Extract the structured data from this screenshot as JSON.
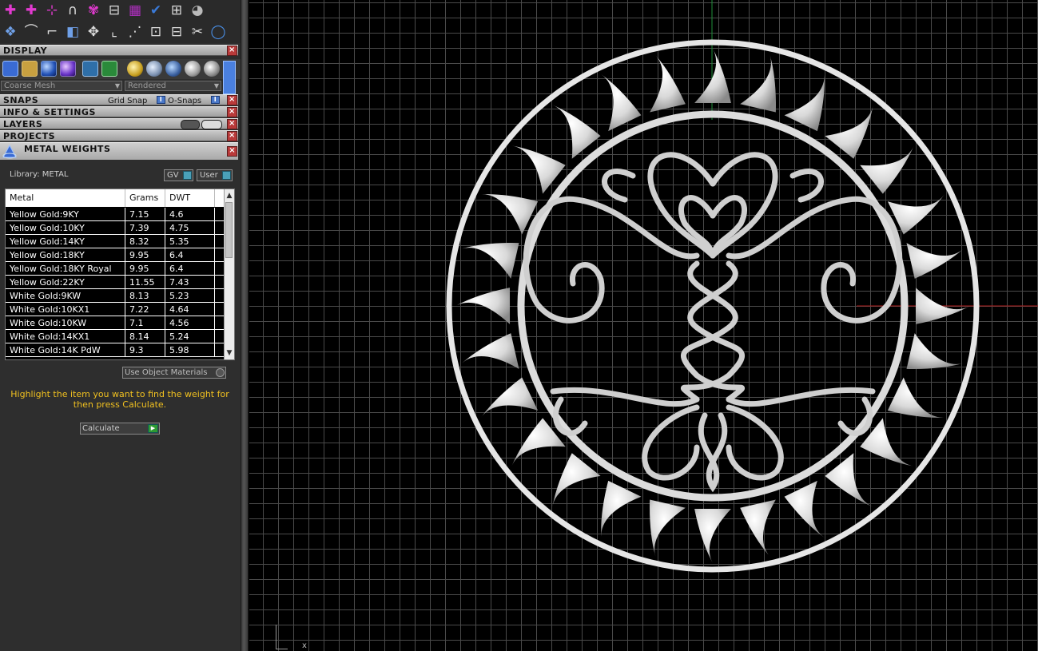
{
  "panels": {
    "display": "DISPLAY",
    "snaps": "SNAPS",
    "grid_snap": "Grid Snap",
    "o_snaps": "O-Snaps",
    "info_settings": "INFO & SETTINGS",
    "layers": "LAYERS",
    "projects": "PROJECTS"
  },
  "display": {
    "mesh_mode": "Coarse Mesh",
    "render_mode": "Rendered"
  },
  "metal_weights": {
    "title": "METAL WEIGHTS",
    "library_label": "Library: METAL",
    "gv": "GV",
    "user": "User",
    "columns": [
      "Metal",
      "Grams",
      "DWT"
    ],
    "rows": [
      {
        "metal": "Yellow Gold:9KY",
        "grams": "7.15",
        "dwt": "4.6"
      },
      {
        "metal": "Yellow Gold:10KY",
        "grams": "7.39",
        "dwt": "4.75"
      },
      {
        "metal": "Yellow Gold:14KY",
        "grams": "8.32",
        "dwt": "5.35"
      },
      {
        "metal": "Yellow Gold:18KY",
        "grams": "9.95",
        "dwt": "6.4"
      },
      {
        "metal": "Yellow Gold:18KY Royal",
        "grams": "9.95",
        "dwt": "6.4"
      },
      {
        "metal": "Yellow Gold:22KY",
        "grams": "11.55",
        "dwt": "7.43"
      },
      {
        "metal": "White Gold:9KW",
        "grams": "8.13",
        "dwt": "5.23"
      },
      {
        "metal": "White Gold:10KX1",
        "grams": "7.22",
        "dwt": "4.64"
      },
      {
        "metal": "White Gold:10KW",
        "grams": "7.1",
        "dwt": "4.56"
      },
      {
        "metal": "White Gold:14KX1",
        "grams": "8.14",
        "dwt": "5.24"
      },
      {
        "metal": "White Gold:14K PdW",
        "grams": "9.3",
        "dwt": "5.98"
      }
    ],
    "use_object_materials": "Use Object Materials",
    "hint": "Highlight the item you want to find the weight for then press Calculate.",
    "calculate": "Calculate"
  },
  "viewport": {
    "axis_x_label": "x"
  },
  "colors": {
    "grid": "#4a4a4a",
    "hint": "#f0c020",
    "axis_red": "#b02020",
    "axis_green": "#1f8f3a"
  }
}
